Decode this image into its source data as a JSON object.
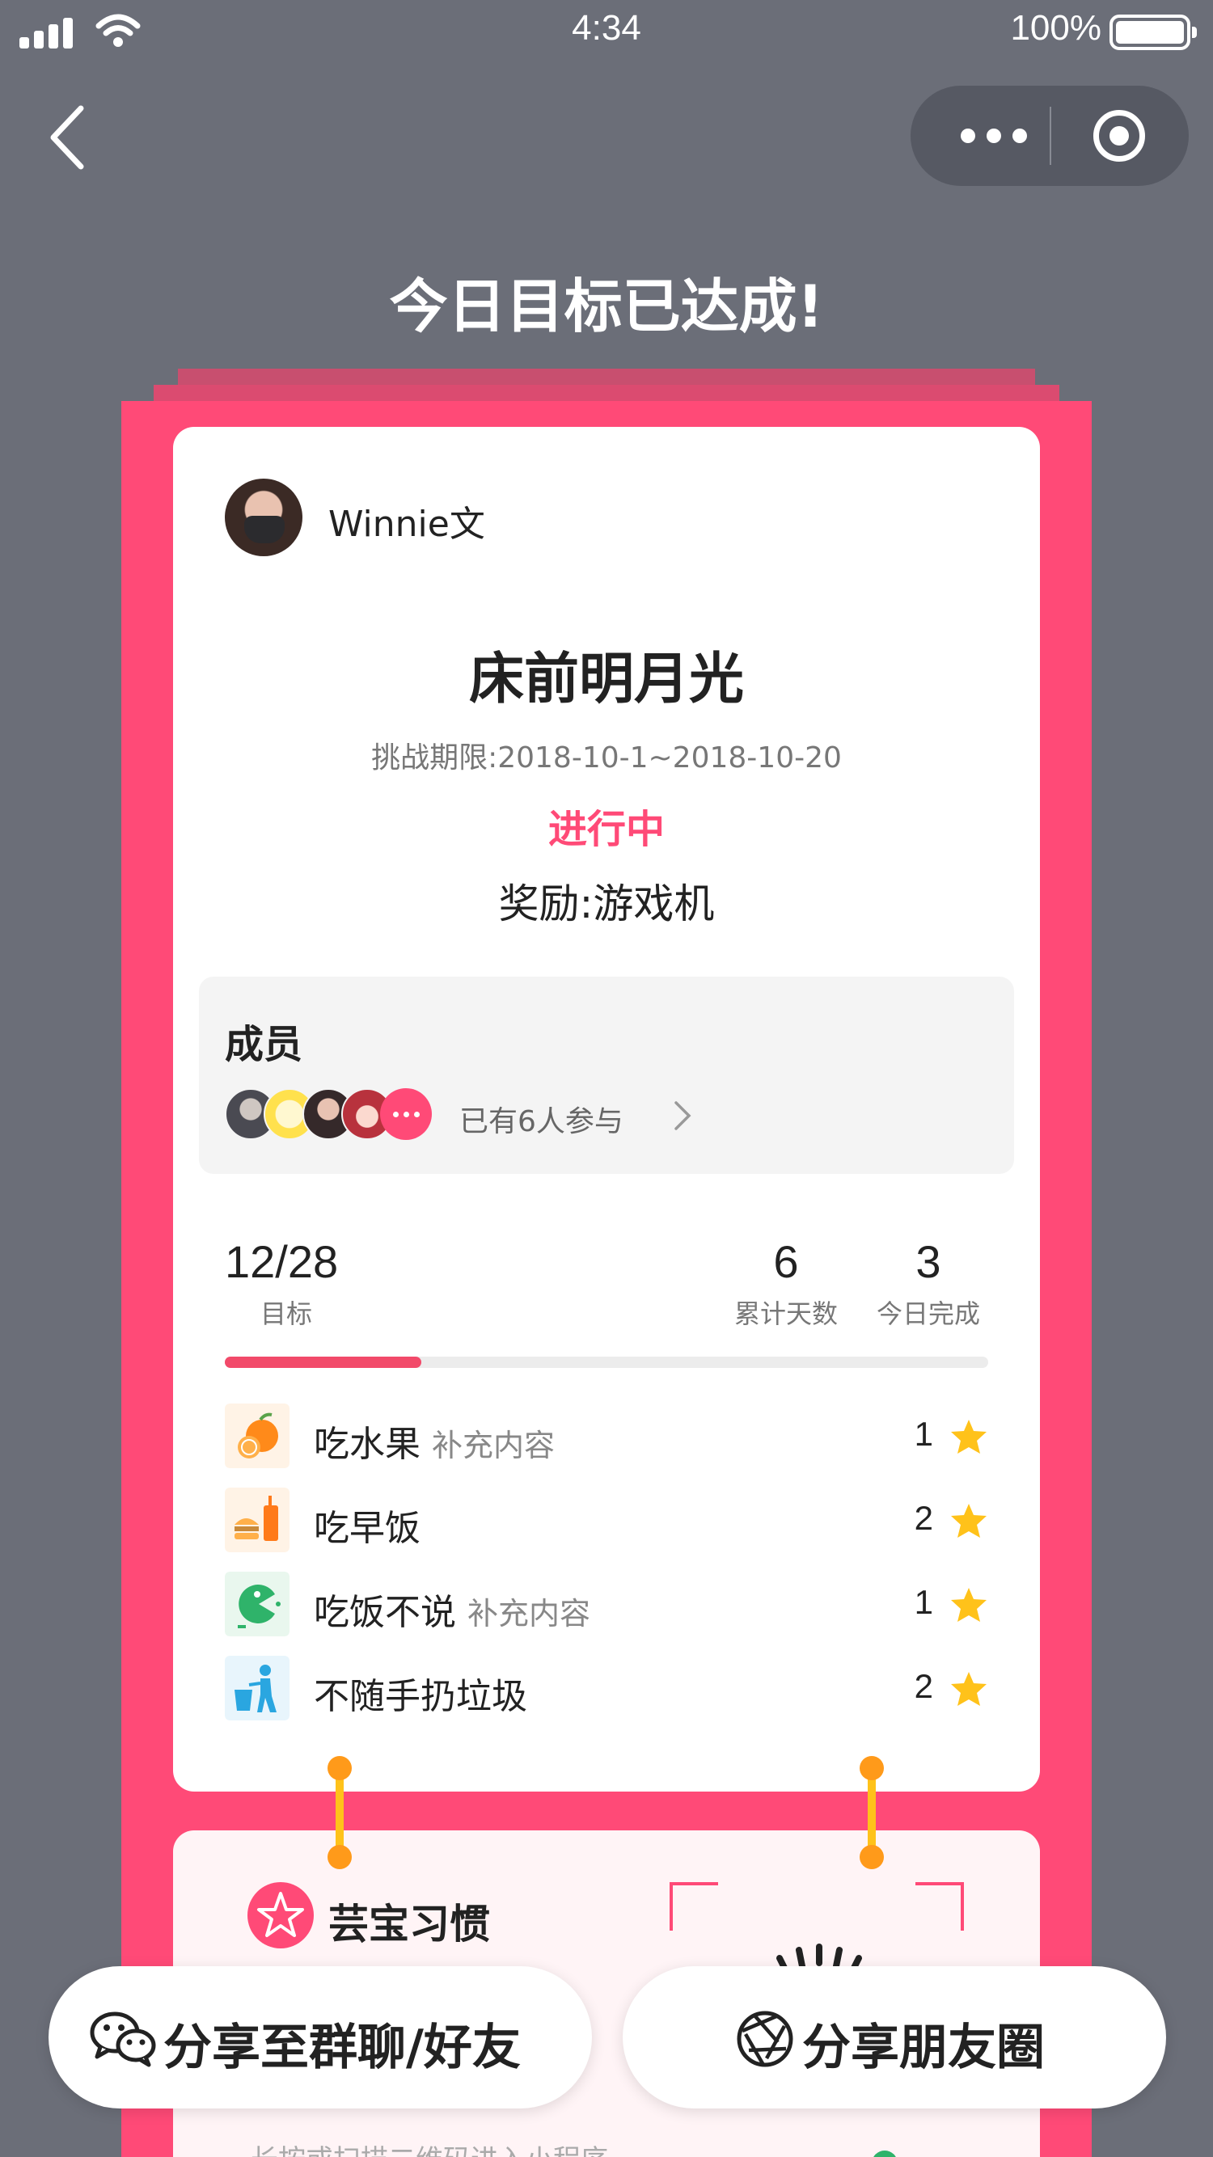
{
  "status_bar": {
    "time": "4:34",
    "battery": "100%"
  },
  "headline": "今日目标已达成!",
  "card": {
    "user_name": "Winnie文",
    "challenge_title": "床前明月光",
    "deadline": "挑战期限:2018-10-1~2018-10-20",
    "status": "进行中",
    "reward": "奖励:游戏机",
    "members": {
      "title": "成员",
      "count_text": "已有6人参与"
    },
    "progress": {
      "value": "12/28",
      "label": "目标",
      "fraction": 0.257
    },
    "stats": [
      {
        "value": "6",
        "label": "累计天数"
      },
      {
        "value": "3",
        "label": "今日完成"
      }
    ],
    "habits": [
      {
        "name": "吃水果",
        "sub": "补充内容",
        "count": "1",
        "icon": "orange-icon"
      },
      {
        "name": "吃早饭",
        "sub": "",
        "count": "2",
        "icon": "breakfast-icon"
      },
      {
        "name": "吃饭不说",
        "sub": "补充内容",
        "count": "1",
        "icon": "pacman-icon"
      },
      {
        "name": "不随手扔垃圾",
        "sub": "",
        "count": "2",
        "icon": "trash-icon"
      }
    ]
  },
  "bottom_card": {
    "brand": "芸宝习惯",
    "hint": "长按或扫描二维码进入小程序"
  },
  "share": {
    "group_label": "分享至群聊/好友",
    "moments_label": "分享朋友圈"
  },
  "colors": {
    "accent": "#ff4a77",
    "background": "#6b6e78",
    "star": "#ffc21a"
  }
}
